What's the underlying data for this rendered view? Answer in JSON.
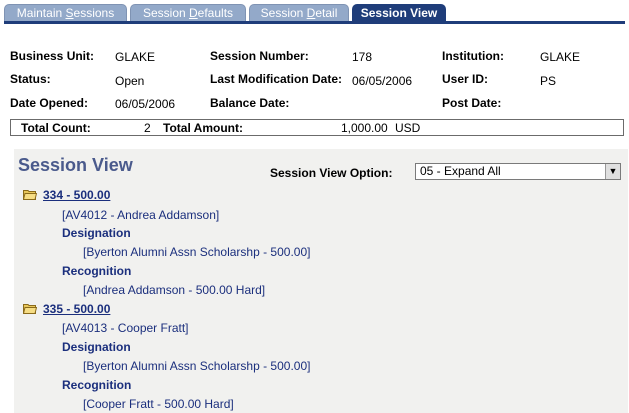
{
  "tabs": [
    {
      "pre": "Maintain ",
      "ul": "S",
      "post": "essions"
    },
    {
      "pre": "Session ",
      "ul": "D",
      "post": "efaults"
    },
    {
      "pre": "Session ",
      "ul": "D",
      "post": "etail"
    },
    {
      "pre": "",
      "ul": "",
      "post": "Session View"
    }
  ],
  "info": {
    "business_unit_label": "Business Unit:",
    "business_unit": "GLAKE",
    "session_number_label": "Session Number:",
    "session_number": "178",
    "institution_label": "Institution:",
    "institution": "GLAKE",
    "status_label": "Status:",
    "status": "Open",
    "last_mod_label": "Last Modification Date:",
    "last_mod": "06/05/2006",
    "user_id_label": "User ID:",
    "user_id": "PS",
    "date_opened_label": "Date Opened:",
    "date_opened": "06/05/2006",
    "balance_date_label": "Balance Date:",
    "post_date_label": "Post Date:"
  },
  "totals": {
    "count_label": "Total Count:",
    "count": "2",
    "amount_label": "Total Amount:",
    "amount": "1,000.00",
    "currency": "USD"
  },
  "session_view": {
    "title": "Session View",
    "option_label": "Session View Option:",
    "option_value": "05 - Expand All",
    "nodes": [
      {
        "link": "334 - 500.00",
        "constituent": "[AV4012 - Andrea Addamson]",
        "designation_label": "Designation",
        "designation": "[Byerton Alumni Assn Scholarshp - 500.00]",
        "recognition_label": "Recognition",
        "recognition": "[Andrea Addamson - 500.00 Hard]"
      },
      {
        "link": "335 - 500.00",
        "constituent": "[AV4013 - Cooper Fratt]",
        "designation_label": "Designation",
        "designation": "[Byerton Alumni Assn Scholarshp - 500.00]",
        "recognition_label": "Recognition",
        "recognition": "[Cooper Fratt - 500.00 Hard]"
      }
    ]
  }
}
